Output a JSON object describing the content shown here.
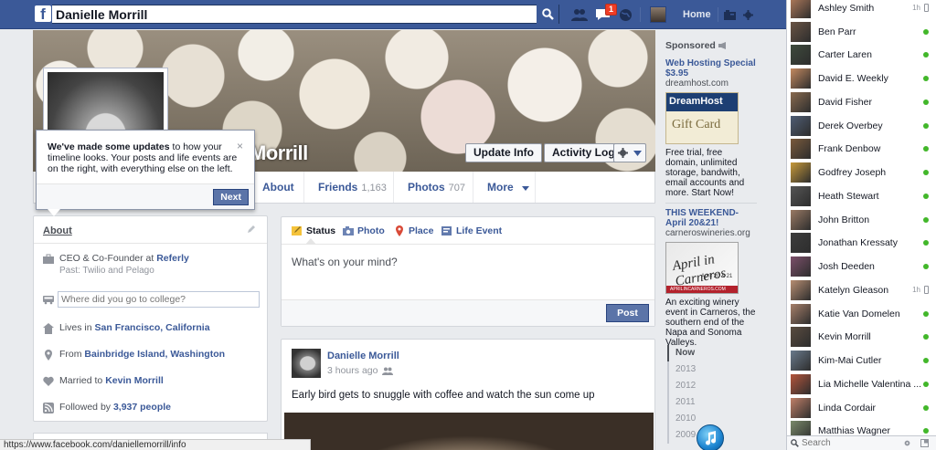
{
  "topbar": {
    "logo_letter": "f",
    "search_value": "Danielle Morrill",
    "notification_count": "1",
    "home_label": "Home",
    "brand_color": "#3b5998"
  },
  "profile": {
    "name": "Danielle Morrill",
    "name_visible": "Morrill",
    "update_info_label": "Update Info",
    "activity_log_label": "Activity Log"
  },
  "tabs": [
    {
      "label": "About",
      "count": ""
    },
    {
      "label": "Friends",
      "count": "1,163"
    },
    {
      "label": "Photos",
      "count": "707"
    },
    {
      "label": "More",
      "count": ""
    }
  ],
  "tooltip": {
    "bold": "We've made some updates",
    "text": " to how your timeline looks. Your posts and life events are on the right, with everything else on the left.",
    "next_label": "Next"
  },
  "about": {
    "title": "About",
    "work_prefix": "CEO & Co-Founder at ",
    "work_company": "Referly",
    "work_past": "Past: Twilio and Pelago",
    "college_placeholder": "Where did you go to college?",
    "lives_prefix": "Lives in ",
    "lives_place": "San Francisco, California",
    "from_prefix": "From ",
    "from_place": "Bainbridge Island, Washington",
    "married_prefix": "Married to ",
    "married_name": "Kevin Morrill",
    "followed_prefix": "Followed by ",
    "followed_count": "3,937 people"
  },
  "composer": {
    "tabs": [
      "Status",
      "Photo",
      "Place",
      "Life Event"
    ],
    "placeholder": "What's on your mind?",
    "post_label": "Post"
  },
  "story": {
    "author": "Danielle Morrill",
    "time": "3 hours ago",
    "text": "Early bird gets to snuggle with coffee and watch the sun come up"
  },
  "timeline": [
    "Now",
    "2013",
    "2012",
    "2011",
    "2010",
    "2009"
  ],
  "sponsored": {
    "title": "Sponsored",
    "ad1": {
      "title": "Web Hosting Special $3.95",
      "url": "dreamhost.com",
      "img_brand": "DreamHost",
      "img_text": "Gift Card",
      "body": "Free trial, free domain, unlimited storage, bandwith, email accounts and more. Start Now!"
    },
    "ad2": {
      "title": "THIS WEEKEND- April 20&21!",
      "url": "carneroswineries.org",
      "img_text": "April in Carneros",
      "img_date": "April 20 & 21",
      "img_footer": "APRILINCARNEROS.COM",
      "body": "An exciting winery event in Carneros, the southern end of the Napa and Sonoma Valleys."
    }
  },
  "chat": {
    "friends": [
      {
        "name": "Ashley Smith",
        "status": "idle",
        "idle": "1h",
        "color": "#b07a5a"
      },
      {
        "name": "Ben Parr",
        "status": "online",
        "color": "#6a5445"
      },
      {
        "name": "Carter Laren",
        "status": "online",
        "color": "#3e4a3c"
      },
      {
        "name": "David E. Weekly",
        "status": "online",
        "color": "#c48a60"
      },
      {
        "name": "David Fisher",
        "status": "online",
        "color": "#8a6b50"
      },
      {
        "name": "Derek Overbey",
        "status": "online",
        "color": "#4f5d74"
      },
      {
        "name": "Frank Denbow",
        "status": "online",
        "color": "#7a5a3c"
      },
      {
        "name": "Godfrey Joseph",
        "status": "online",
        "color": "#c79a3a"
      },
      {
        "name": "Heath Stewart",
        "status": "online",
        "color": "#555555"
      },
      {
        "name": "John Britton",
        "status": "online",
        "color": "#9a7a64"
      },
      {
        "name": "Jonathan Kressaty",
        "status": "online",
        "color": "#3d3d3d"
      },
      {
        "name": "Josh Deeden",
        "status": "online",
        "color": "#7c4f6a"
      },
      {
        "name": "Katelyn Gleason",
        "status": "idle",
        "idle": "1h",
        "color": "#b78e72"
      },
      {
        "name": "Katie Van Domelen",
        "status": "online",
        "color": "#a7806a"
      },
      {
        "name": "Kevin Morrill",
        "status": "online",
        "color": "#5a4c40"
      },
      {
        "name": "Kim-Mai Cutler",
        "status": "online",
        "color": "#6a7a8c"
      },
      {
        "name": "Lia Michelle Valentina ...",
        "status": "online",
        "color": "#b4553c"
      },
      {
        "name": "Linda Cordair",
        "status": "online",
        "color": "#c18068"
      },
      {
        "name": "Matthias Wagner",
        "status": "online",
        "color": "#7a8a6a"
      }
    ],
    "search_placeholder": "Search"
  },
  "statusbar": {
    "url": "https://www.facebook.com/daniellemorrill/info"
  }
}
